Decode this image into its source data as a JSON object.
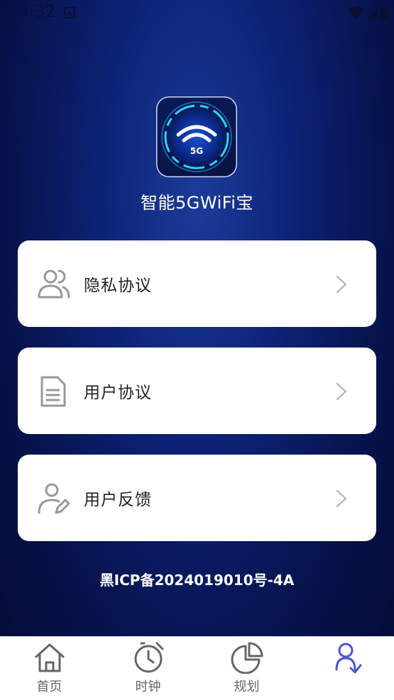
{
  "status_bar": {
    "time": "10:32"
  },
  "app": {
    "name": "智能5GWiFi宝",
    "icon_badge": "5G"
  },
  "menu": {
    "items": [
      {
        "label": "隐私协议",
        "icon": "users-icon"
      },
      {
        "label": "用户协议",
        "icon": "document-icon"
      },
      {
        "label": "用户反馈",
        "icon": "user-edit-icon"
      }
    ]
  },
  "icp": "黑ICP备2024019010号-4A",
  "tabs": [
    {
      "label": "首页",
      "icon": "home-icon"
    },
    {
      "label": "时钟",
      "icon": "alarm-clock-icon"
    },
    {
      "label": "规划",
      "icon": "pie-chart-icon"
    },
    {
      "label": "",
      "icon": "profile-icon",
      "active": true
    }
  ],
  "colors": {
    "background": "#0d2275",
    "card": "#ffffff",
    "active_tab": "#4a55d6"
  }
}
